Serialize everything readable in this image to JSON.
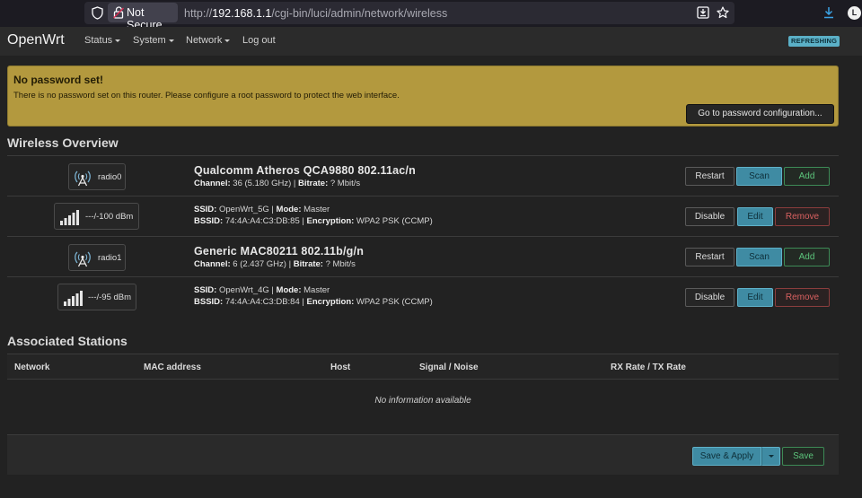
{
  "browser": {
    "security_label": "Not Secure",
    "url_prefix": "http://",
    "url_host": "192.168.1.1",
    "url_path": "/cgi-bin/luci/admin/network/wireless",
    "profile_initial": "L"
  },
  "header": {
    "brand": "OpenWrt",
    "menu": [
      "Status",
      "System",
      "Network"
    ],
    "logout": "Log out",
    "badge": "REFRESHING"
  },
  "alert": {
    "title": "No password set!",
    "message": "There is no password set on this router. Please configure a root password to protect the web interface.",
    "button": "Go to password configuration..."
  },
  "wireless": {
    "heading": "Wireless Overview",
    "radios": [
      {
        "icon_label": "radio0",
        "name": "Qualcomm Atheros QCA9880 802.11ac/n",
        "channel_key": "Channel:",
        "channel_val": " 36 (5.180 GHz) | ",
        "bitrate_key": "Bitrate:",
        "bitrate_val": " ? Mbit/s",
        "buttons": [
          "Restart",
          "Scan",
          "Add"
        ],
        "network": {
          "signal": "---/-100 dBm",
          "ssid_key": "SSID:",
          "ssid_val": " OpenWrt_5G | ",
          "mode_key": "Mode:",
          "mode_val": " Master",
          "bssid_key": "BSSID:",
          "bssid_val": " 74:4A:A4:C3:DB:85 | ",
          "enc_key": "Encryption:",
          "enc_val": " WPA2 PSK (CCMP)",
          "buttons": [
            "Disable",
            "Edit",
            "Remove"
          ]
        }
      },
      {
        "icon_label": "radio1",
        "name": "Generic MAC80211 802.11b/g/n",
        "channel_key": "Channel:",
        "channel_val": " 6 (2.437 GHz) | ",
        "bitrate_key": "Bitrate:",
        "bitrate_val": " ? Mbit/s",
        "buttons": [
          "Restart",
          "Scan",
          "Add"
        ],
        "network": {
          "signal": "---/-95 dBm",
          "ssid_key": "SSID:",
          "ssid_val": " OpenWrt_4G | ",
          "mode_key": "Mode:",
          "mode_val": " Master",
          "bssid_key": "BSSID:",
          "bssid_val": " 74:4A:A4:C3:DB:84 | ",
          "enc_key": "Encryption:",
          "enc_val": " WPA2 PSK (CCMP)",
          "buttons": [
            "Disable",
            "Edit",
            "Remove"
          ]
        }
      }
    ]
  },
  "stations": {
    "heading": "Associated Stations",
    "columns": [
      "Network",
      "MAC address",
      "Host",
      "Signal / Noise",
      "RX Rate / TX Rate"
    ],
    "empty": "No information available"
  },
  "footer": {
    "save_apply": "Save & Apply",
    "save": "Save"
  }
}
